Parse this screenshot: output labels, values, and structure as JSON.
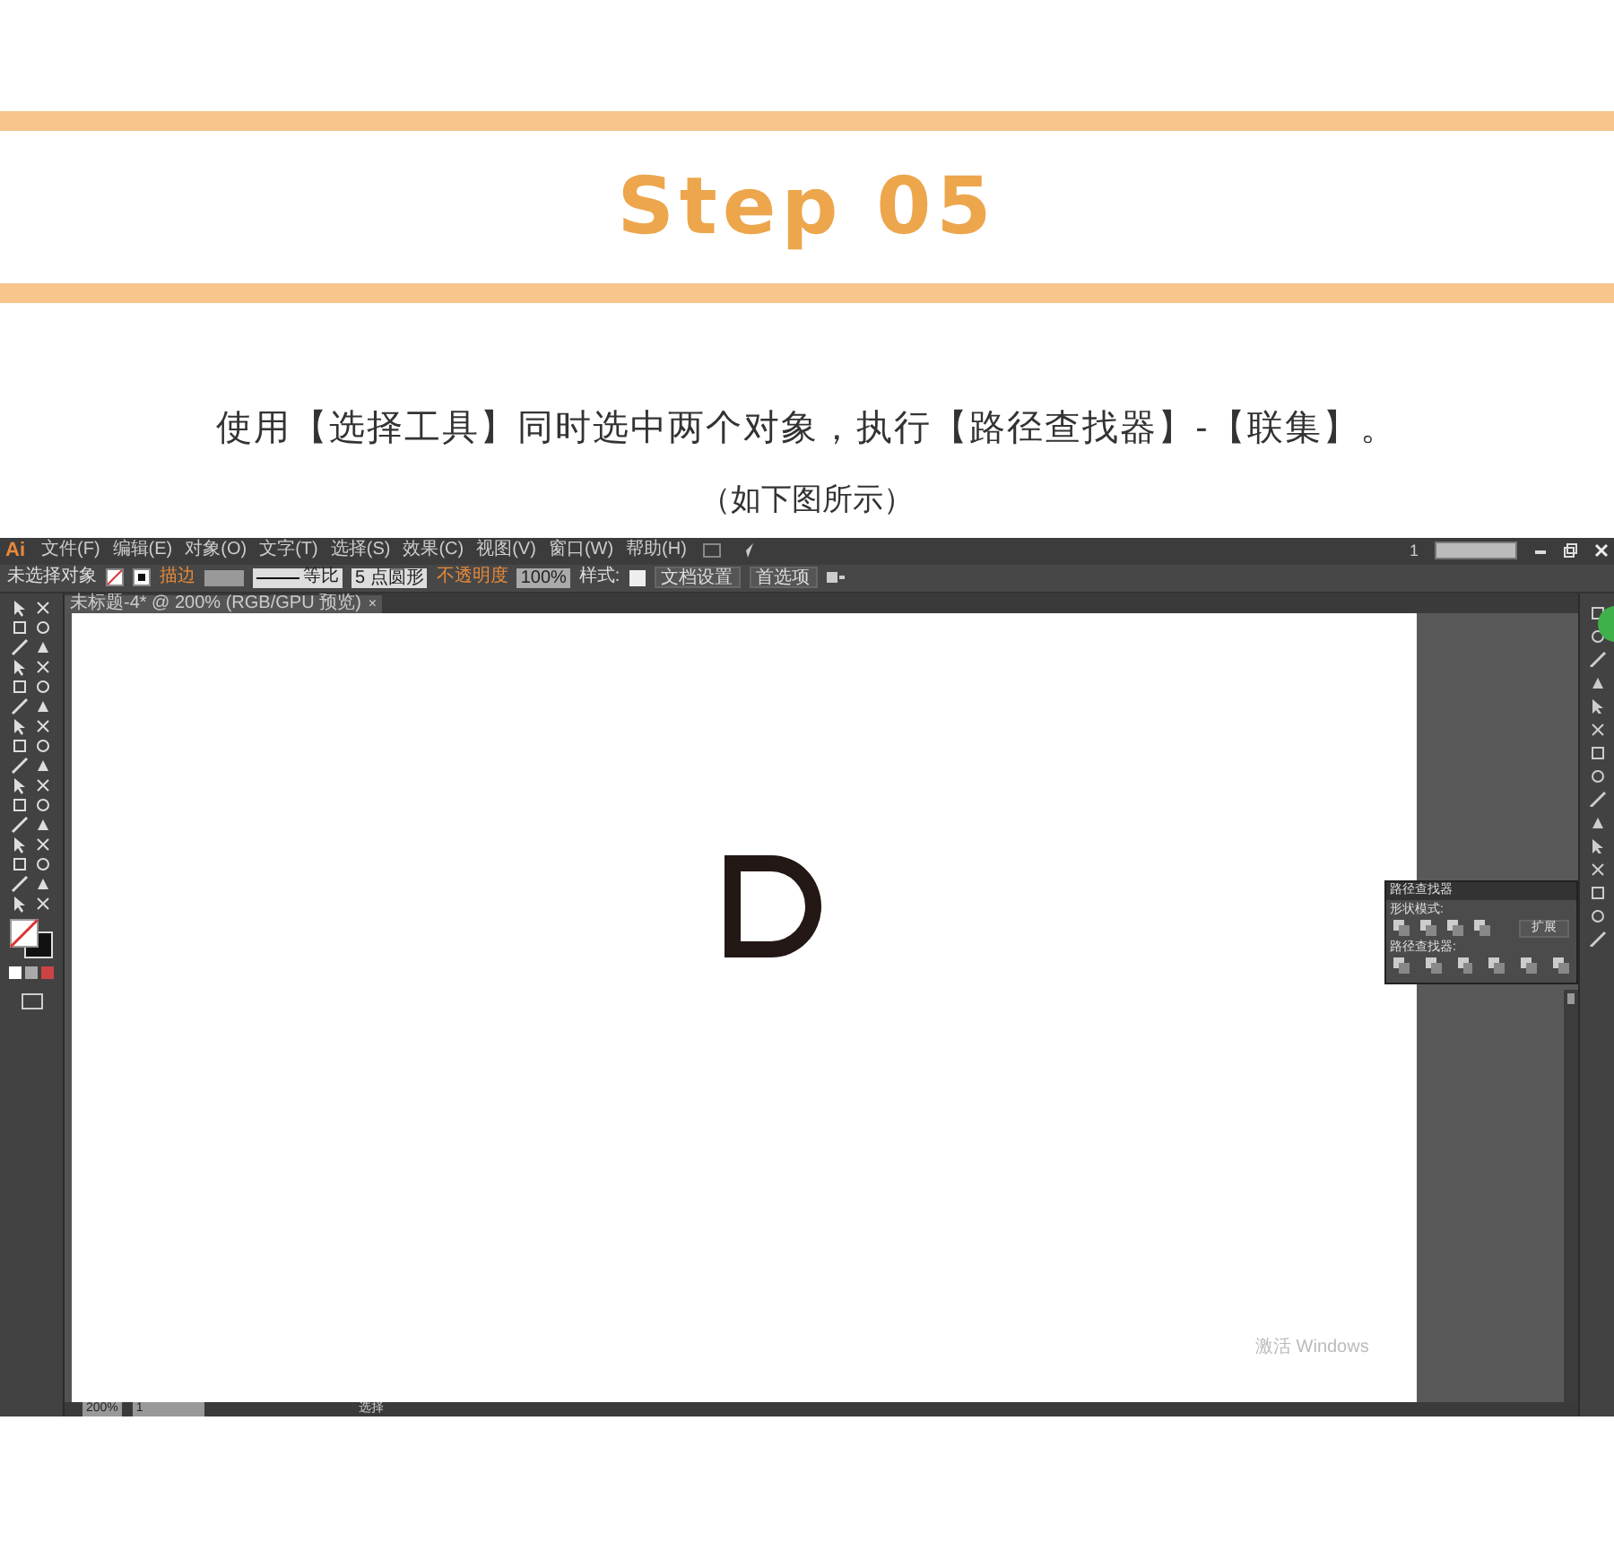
{
  "header": {
    "step_title": "Step 05"
  },
  "instruction": "使用【选择工具】同时选中两个对象，执行【路径查找器】-【联集】。",
  "caption": "（如下图所示）",
  "app": {
    "logo": "Ai",
    "menu": [
      "文件(F)",
      "编辑(E)",
      "对象(O)",
      "文字(T)",
      "选择(S)",
      "效果(C)",
      "视图(V)",
      "窗口(W)",
      "帮助(H)"
    ],
    "workspace": "1",
    "control_bar": {
      "selection": "未选择对象",
      "stroke_label": "描边",
      "stroke_profile": "等比",
      "brush": "5 点圆形",
      "opacity_label": "不透明度",
      "opacity": "100%",
      "style_label": "样式:",
      "buttons": [
        "文档设置",
        "首选项"
      ]
    },
    "document_tab": {
      "title": "未标题-4* @ 200% (RGB/GPU 预览)",
      "close": "×"
    },
    "pathfinder": {
      "title": "路径查找器",
      "shape_modes_label": "形状模式:",
      "expand": "扩展",
      "pathfinders_label": "路径查找器:"
    },
    "status": {
      "zoom": "200%",
      "artboard": "1",
      "tool": "选择"
    },
    "os_notice": "激活 Windows"
  }
}
